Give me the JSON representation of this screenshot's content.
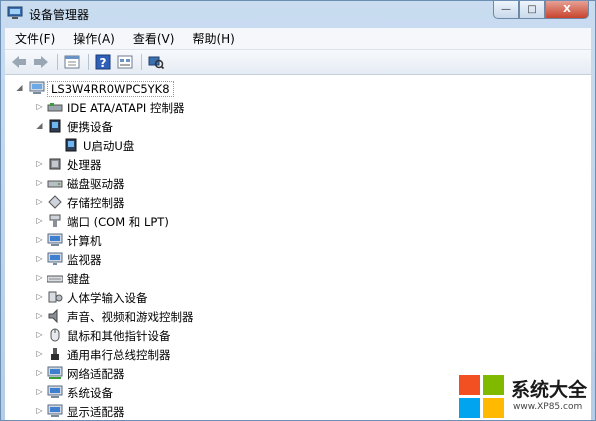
{
  "window": {
    "title": "设备管理器",
    "icon": "device-manager-icon"
  },
  "caption_buttons": {
    "minimize": "—",
    "maximize": "□",
    "close": "X"
  },
  "menu": [
    "文件(F)",
    "操作(A)",
    "查看(V)",
    "帮助(H)"
  ],
  "toolbar": [
    "back-arrow-icon",
    "forward-arrow-icon",
    "properties-icon",
    "help-icon",
    "view-icon",
    "scan-hardware-icon"
  ],
  "tree": {
    "root": "LS3W4RR0WPC5YK8",
    "items": [
      {
        "label": "IDE ATA/ATAPI 控制器",
        "icon": "ide-controller-icon",
        "state": "collapsed"
      },
      {
        "label": "便携设备",
        "icon": "portable-device-icon",
        "state": "expanded",
        "children": [
          {
            "label": "U启动U盘",
            "icon": "usb-drive-icon"
          }
        ]
      },
      {
        "label": "处理器",
        "icon": "processor-icon",
        "state": "collapsed"
      },
      {
        "label": "磁盘驱动器",
        "icon": "disk-drive-icon",
        "state": "collapsed"
      },
      {
        "label": "存储控制器",
        "icon": "storage-controller-icon",
        "state": "collapsed"
      },
      {
        "label": "端口 (COM 和 LPT)",
        "icon": "port-icon",
        "state": "collapsed"
      },
      {
        "label": "计算机",
        "icon": "computer-icon",
        "state": "collapsed"
      },
      {
        "label": "监视器",
        "icon": "monitor-icon",
        "state": "collapsed"
      },
      {
        "label": "键盘",
        "icon": "keyboard-icon",
        "state": "collapsed"
      },
      {
        "label": "人体学输入设备",
        "icon": "hid-icon",
        "state": "collapsed"
      },
      {
        "label": "声音、视频和游戏控制器",
        "icon": "sound-icon",
        "state": "collapsed"
      },
      {
        "label": "鼠标和其他指针设备",
        "icon": "mouse-icon",
        "state": "collapsed"
      },
      {
        "label": "通用串行总线控制器",
        "icon": "usb-controller-icon",
        "state": "collapsed"
      },
      {
        "label": "网络适配器",
        "icon": "network-adapter-icon",
        "state": "collapsed"
      },
      {
        "label": "系统设备",
        "icon": "system-device-icon",
        "state": "collapsed"
      },
      {
        "label": "显示适配器",
        "icon": "display-adapter-icon",
        "state": "collapsed"
      }
    ]
  },
  "watermark": {
    "text": "系统大全",
    "url": "www.XP85.com"
  }
}
